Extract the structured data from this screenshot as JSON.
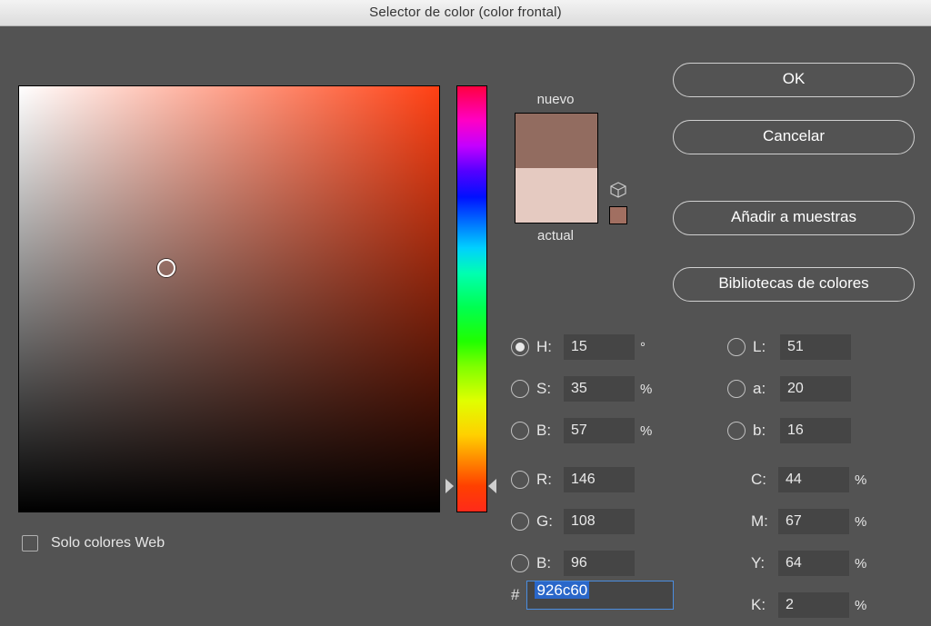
{
  "title": "Selector de color (color frontal)",
  "swatch": {
    "new_label": "nuevo",
    "current_label": "actual",
    "new_color": "#926c60",
    "current_color": "#e5cac1"
  },
  "buttons": {
    "ok": "OK",
    "cancel": "Cancelar",
    "add_swatches": "Añadir a muestras",
    "color_libraries": "Bibliotecas de colores"
  },
  "web_only": {
    "label": "Solo colores Web",
    "checked": false
  },
  "hsb": {
    "h_label": "H:",
    "h_value": "15",
    "h_unit": "°",
    "s_label": "S:",
    "s_value": "35",
    "s_unit": "%",
    "b_label": "B:",
    "b_value": "57",
    "b_unit": "%",
    "selected": "H"
  },
  "lab": {
    "l_label": "L:",
    "l_value": "51",
    "a_label": "a:",
    "a_value": "20",
    "b_label": "b:",
    "b_value": "16"
  },
  "rgb": {
    "r_label": "R:",
    "r_value": "146",
    "g_label": "G:",
    "g_value": "108",
    "b_label": "B:",
    "b_value": "96"
  },
  "cmyk": {
    "c_label": "C:",
    "c_value": "44",
    "c_unit": "%",
    "m_label": "M:",
    "m_value": "67",
    "m_unit": "%",
    "y_label": "Y:",
    "y_value": "64",
    "y_unit": "%",
    "k_label": "K:",
    "k_value": "2",
    "k_unit": "%"
  },
  "hex": {
    "hash": "#",
    "value": "926c60"
  }
}
